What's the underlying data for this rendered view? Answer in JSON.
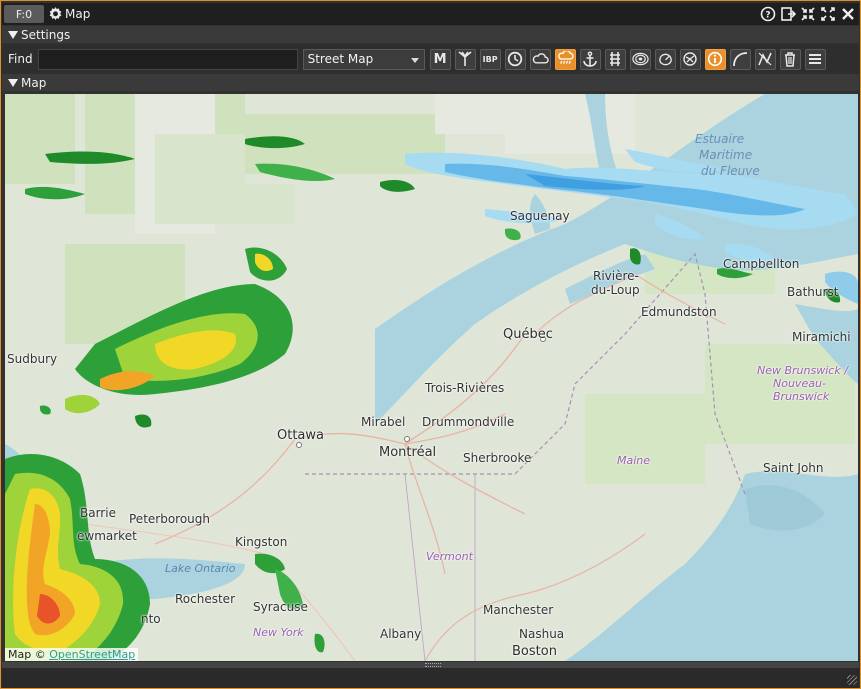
{
  "window": {
    "badge": "F:0",
    "title": "Map",
    "buttons": [
      "help-icon",
      "undock-icon",
      "shrink-icon",
      "maximize-icon",
      "close-icon"
    ]
  },
  "settings_section": {
    "label": "Settings"
  },
  "toolbar": {
    "find_label": "Find",
    "find_value": "",
    "map_type": "Street Map",
    "m_button": "M",
    "ibp_button": "IBP",
    "tools": [
      "m",
      "antenna",
      "ibp",
      "clock",
      "clouds",
      "rain",
      "anchor",
      "rail",
      "radar-rings",
      "weather-radar",
      "satellite",
      "info",
      "arc",
      "route",
      "trash",
      "menu"
    ]
  },
  "map_section": {
    "label": "Map"
  },
  "map": {
    "labels": {
      "estuaire": "Estuaire",
      "maritime": "Maritime",
      "dufleuve": "du Fleuve",
      "saguenay": "Saguenay",
      "riviere": "Rivière-",
      "duloup": "du-Loup",
      "campbellton": "Campbellton",
      "bathurst": "Bathurst",
      "edmundston": "Edmundston",
      "miramichi": "Miramichi",
      "sudbury": "Sudbury",
      "quebec": "Québec",
      "nb1": "New Brunswick /",
      "nb2": "Nouveau-",
      "nb3": "Brunswick",
      "troisrivieres": "Trois-Rivières",
      "mirabel": "Mirabel",
      "drummondville": "Drummondville",
      "ottawa": "Ottawa",
      "montreal": "Montréal",
      "sherbrooke": "Sherbrooke",
      "maine": "Maine",
      "saintjohn": "Saint John",
      "barrie": "Barrie",
      "peterborough": "Peterborough",
      "newmarket": "ewmarket",
      "kingston": "Kingston",
      "vermont": "Vermont",
      "lakeontario": "Lake Ontario",
      "rochester": "Rochester",
      "syracuse": "Syracuse",
      "manchester": "Manchester",
      "toronto": "nto",
      "newyork": "New York",
      "albany": "Albany",
      "nashua": "Nashua",
      "boston": "Boston"
    },
    "attribution_prefix": "Map ©",
    "attribution_link": "OpenStreetMap"
  },
  "colors": {
    "accent": "#e8902a",
    "water": "#aad3df",
    "land": "#dfe6d8",
    "forest": "#c8dfb4"
  }
}
